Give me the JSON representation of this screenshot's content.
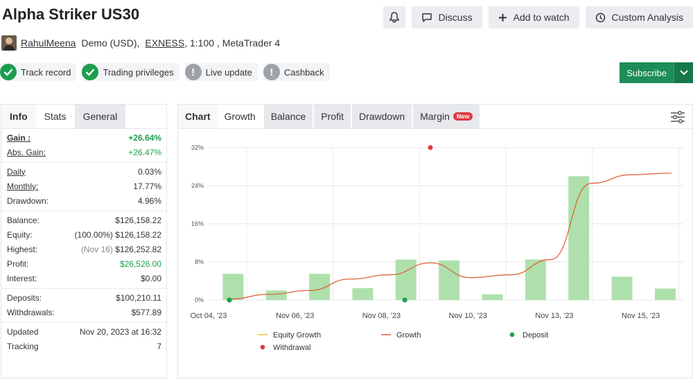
{
  "header": {
    "title": "Alpha Striker US30",
    "discuss_label": "Discuss",
    "watch_label": "Add to watch",
    "analysis_label": "Custom Analysis"
  },
  "account": {
    "username": "RahulMeena",
    "type": "Demo (USD),",
    "broker": "EXNESS",
    "leverage": ", 1:100 , MetaTrader 4"
  },
  "badges": [
    {
      "label": "Track record",
      "status": "ok"
    },
    {
      "label": "Trading privileges",
      "status": "ok"
    },
    {
      "label": "Live update",
      "status": "warn"
    },
    {
      "label": "Cashback",
      "status": "warn"
    }
  ],
  "subscribe_label": "Subscribe",
  "left_tabs": [
    "Info",
    "Stats",
    "General"
  ],
  "stats": {
    "gain_label": "Gain :",
    "gain_value": "+26.64%",
    "abs_gain_label": "Abs. Gain:",
    "abs_gain_value": "+26.47%",
    "daily_label": "Daily",
    "daily_value": "0.03%",
    "monthly_label": "Monthly:",
    "monthly_value": "17.77%",
    "drawdown_label": "Drawdown:",
    "drawdown_value": "4.96%",
    "balance_label": "Balance:",
    "balance_value": "$126,158.22",
    "equity_label": "Equity:",
    "equity_note": "(100.00%)",
    "equity_value": "$126,158.22",
    "highest_label": "Highest:",
    "highest_note": "(Nov 16)",
    "highest_value": "$126,252.82",
    "profit_label": "Profit:",
    "profit_value": "$26,526.00",
    "interest_label": "Interest:",
    "interest_value": "$0.00",
    "deposits_label": "Deposits:",
    "deposits_value": "$100,210.11",
    "withdrawals_label": "Withdrawals:",
    "withdrawals_value": "$577.89",
    "updated_label": "Updated",
    "updated_value": "Nov 20, 2023 at 16:32",
    "tracking_label": "Tracking",
    "tracking_value": "7"
  },
  "chart_tabs": [
    "Chart",
    "Growth",
    "Balance",
    "Profit",
    "Drawdown",
    "Margin"
  ],
  "new_badge": "New",
  "chart_data": {
    "type": "bar",
    "y_ticks": [
      "0%",
      "8%",
      "16%",
      "24%",
      "32%"
    ],
    "ylim": [
      0,
      32
    ],
    "x_tick_labels": [
      "Oct 04, '23",
      "Nov 06, '23",
      "Nov 08, '23",
      "Nov 10, '23",
      "Nov 13, '23",
      "Nov 15, '23"
    ],
    "bars": [
      5.5,
      2.0,
      5.5,
      2.5,
      8.5,
      8.3,
      1.2,
      8.5,
      26.0,
      4.9,
      2.4
    ],
    "growth_line": [
      0.2,
      1.2,
      2.0,
      4.4,
      5.3,
      7.8,
      4.7,
      5.3,
      8.5,
      24.5,
      26.3,
      26.64
    ],
    "deposits": [
      0,
      4.5,
      0,
      19.5
    ],
    "withdrawals": [
      {
        "x": 5.0,
        "y": 32
      }
    ],
    "legend": [
      {
        "label": "Equity Growth",
        "color": "#e8c23a",
        "kind": "line"
      },
      {
        "label": "Growth",
        "color": "#e0633a",
        "kind": "line"
      },
      {
        "label": "Deposit",
        "color": "#1aa34a",
        "kind": "dot"
      },
      {
        "label": "Withdrawal",
        "color": "#e03a3a",
        "kind": "dot"
      }
    ]
  }
}
